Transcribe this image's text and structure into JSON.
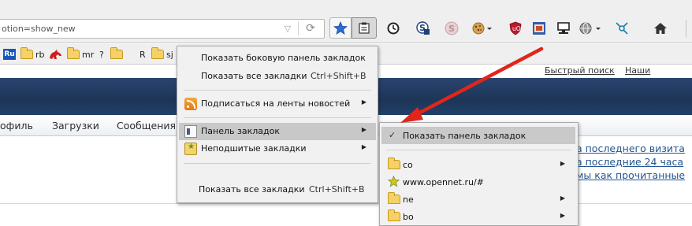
{
  "urlbar": {
    "text": "otion=show_new",
    "dropdown_icon": "dropdown-triangle-icon",
    "reload_icon": "reload-icon"
  },
  "toolbar": {
    "buttons": [
      "star-icon",
      "bookmarks-menu-icon",
      "history-clock-icon",
      "s-extension-icon",
      "s-gray-extension-icon",
      "cookie-icon",
      "ublock-icon",
      "photo-extension-icon",
      "computer-icon",
      "globe-icon",
      "network-icon",
      "home-icon"
    ],
    "colors": {
      "star": "#2a6bd6",
      "ublock": "#c0162a"
    }
  },
  "bookmarks_bar": {
    "items": [
      {
        "icon": "ru-icon",
        "label": "Ru"
      },
      {
        "icon": "folder-icon",
        "label": "rb"
      },
      {
        "icon": "horse-icon",
        "label": ""
      },
      {
        "icon": "folder-icon",
        "label": "mr"
      },
      {
        "icon": "help-icon",
        "label": "?"
      },
      {
        "icon": "folder-icon",
        "label": "R"
      },
      {
        "icon": "folder-icon",
        "label": "sj"
      }
    ]
  },
  "page": {
    "top_links": [
      "Быстрый поиск",
      "Наши проекты"
    ],
    "nav": [
      "офиль",
      "Загрузки",
      "Сообщения"
    ],
    "right_links": [
      "а последнего визита",
      "а последние 24 часа",
      "мы как прочитанные"
    ]
  },
  "bookmarks_menu": {
    "items": [
      {
        "label": "Показать боковую панель закладок",
        "shortcut": ""
      },
      {
        "label": "Показать все закладки",
        "shortcut": "Ctrl+Shift+B"
      },
      {
        "label": "Подписаться на ленты новостей",
        "submenu": true
      },
      {
        "label": "Панель закладок",
        "submenu": true
      },
      {
        "label": "Неподшитые закладки",
        "submenu": true
      },
      {
        "label": "Показать все закладки",
        "shortcut": "Ctrl+Shift+B"
      }
    ]
  },
  "bookmarks_toolbar_submenu": {
    "show_toggle": {
      "label": "Показать панель закладок",
      "checked": true
    },
    "items": [
      {
        "icon": "folder-icon",
        "label": "co",
        "submenu": true
      },
      {
        "icon": "star-bookmark-icon",
        "label": "www.opennet.ru/#",
        "submenu": false
      },
      {
        "icon": "folder-icon",
        "label": "ne",
        "submenu": true
      },
      {
        "icon": "folder-icon",
        "label": "bo",
        "submenu": true
      }
    ]
  },
  "annotation": {
    "color": "#e0261b"
  }
}
